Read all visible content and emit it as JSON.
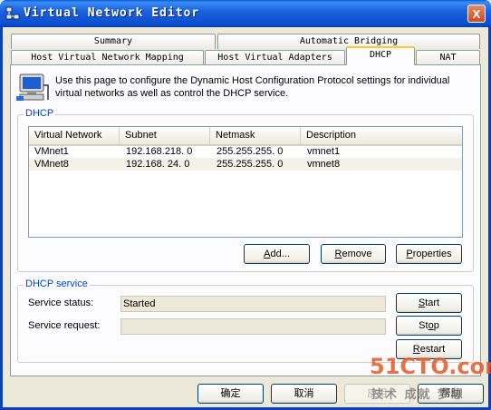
{
  "window": {
    "title": "Virtual Network Editor",
    "close_label": "X"
  },
  "tabs": {
    "summary": "Summary",
    "automatic_bridging": "Automatic Bridging",
    "host_mapping": "Host Virtual Network Mapping",
    "host_adapters": "Host Virtual Adapters",
    "dhcp": "DHCP",
    "nat": "NAT"
  },
  "description": "Use this page to configure the Dynamic Host Configuration Protocol settings for individual virtual networks as well as control the DHCP service.",
  "dhcp_group": {
    "title": "DHCP",
    "columns": [
      "Virtual Network",
      "Subnet",
      "Netmask",
      "Description"
    ],
    "rows": [
      [
        "VMnet1",
        "192.168.218.  0",
        "255.255.255.  0",
        "vmnet1"
      ],
      [
        "VMnet8",
        "192.168. 24.  0",
        "255.255.255.  0",
        "vmnet8"
      ]
    ],
    "buttons": {
      "add_pre": "",
      "add_ul": "A",
      "add_post": "dd...",
      "remove_pre": "",
      "remove_ul": "R",
      "remove_post": "emove",
      "properties_pre": "",
      "properties_ul": "P",
      "properties_post": "roperties"
    }
  },
  "service_group": {
    "title": "DHCP service",
    "status_label": "Service status:",
    "status_value": "Started",
    "request_label": "Service request:",
    "request_value": "",
    "buttons": {
      "start_pre": "",
      "start_ul": "S",
      "start_post": "tart",
      "stop_pre": "St",
      "stop_ul": "o",
      "stop_post": "p",
      "restart_pre": "",
      "restart_ul": "R",
      "restart_post": "estart"
    }
  },
  "footer": {
    "ok": "确定",
    "cancel": "取消",
    "apply": "应用",
    "help": "帮助"
  },
  "watermark": {
    "logo": "51CTO.com",
    "tagline": "技术 成就 梦想"
  },
  "colors": {
    "titlebar": "#0a4fcf",
    "accent_tab": "#ffc83c",
    "group_title": "#0046d5"
  }
}
